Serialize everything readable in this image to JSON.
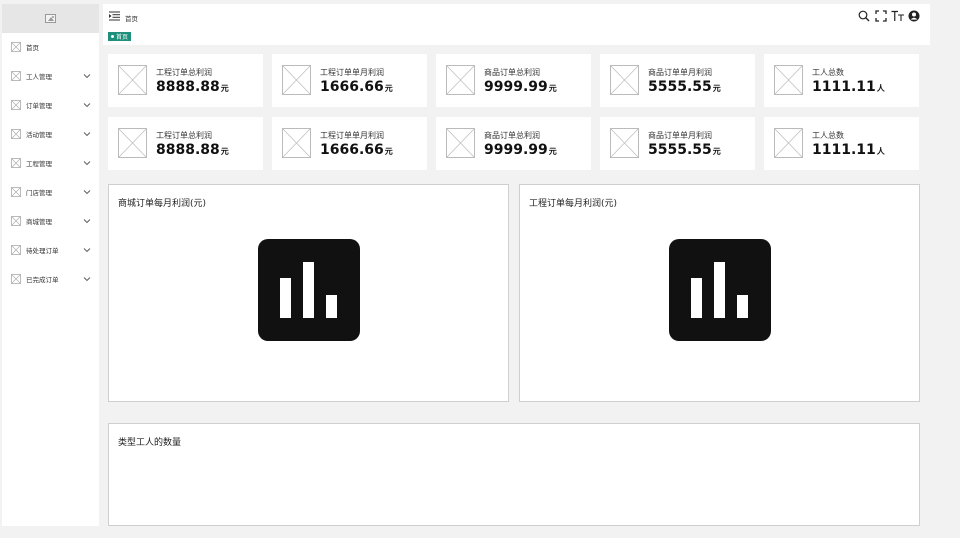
{
  "sidebar": {
    "items": [
      {
        "label": "首页",
        "has_children": false
      },
      {
        "label": "工人管理",
        "has_children": true
      },
      {
        "label": "订单管理",
        "has_children": true
      },
      {
        "label": "活动管理",
        "has_children": true
      },
      {
        "label": "工程管理",
        "has_children": true
      },
      {
        "label": "门店管理",
        "has_children": true
      },
      {
        "label": "商城管理",
        "has_children": true
      },
      {
        "label": "待处理订单",
        "has_children": true
      },
      {
        "label": "已完成订单",
        "has_children": true
      }
    ]
  },
  "header": {
    "breadcrumb": "首页",
    "active_tag": "首页",
    "icons": [
      "search-icon",
      "fullscreen-icon",
      "font-size-icon",
      "user-icon"
    ]
  },
  "stats": {
    "row1": [
      {
        "label": "工程订单总利润",
        "value": "8888.88",
        "unit": "元"
      },
      {
        "label": "工程订单单月利润",
        "value": "1666.66",
        "unit": "元"
      },
      {
        "label": "商品订单总利润",
        "value": "9999.99",
        "unit": "元"
      },
      {
        "label": "商品订单单月利润",
        "value": "5555.55",
        "unit": "元"
      },
      {
        "label": "工人总数",
        "value": "1111.11",
        "unit": "人"
      }
    ],
    "row2": [
      {
        "label": "工程订单总利润",
        "value": "8888.88",
        "unit": "元"
      },
      {
        "label": "工程订单单月利润",
        "value": "1666.66",
        "unit": "元"
      },
      {
        "label": "商品订单总利润",
        "value": "9999.99",
        "unit": "元"
      },
      {
        "label": "商品订单单月利润",
        "value": "5555.55",
        "unit": "元"
      },
      {
        "label": "工人总数",
        "value": "1111.11",
        "unit": "人"
      }
    ]
  },
  "panels": {
    "mall_monthly": {
      "title": "商城订单每月利润(元)"
    },
    "project_monthly": {
      "title": "工程订单每月利润(元)"
    },
    "worker_types": {
      "title": "类型工人的数量"
    }
  },
  "colors": {
    "accent": "#1e8f7a",
    "background": "#f2f2f2",
    "surface": "#ffffff",
    "chart_placeholder": "#111111"
  }
}
